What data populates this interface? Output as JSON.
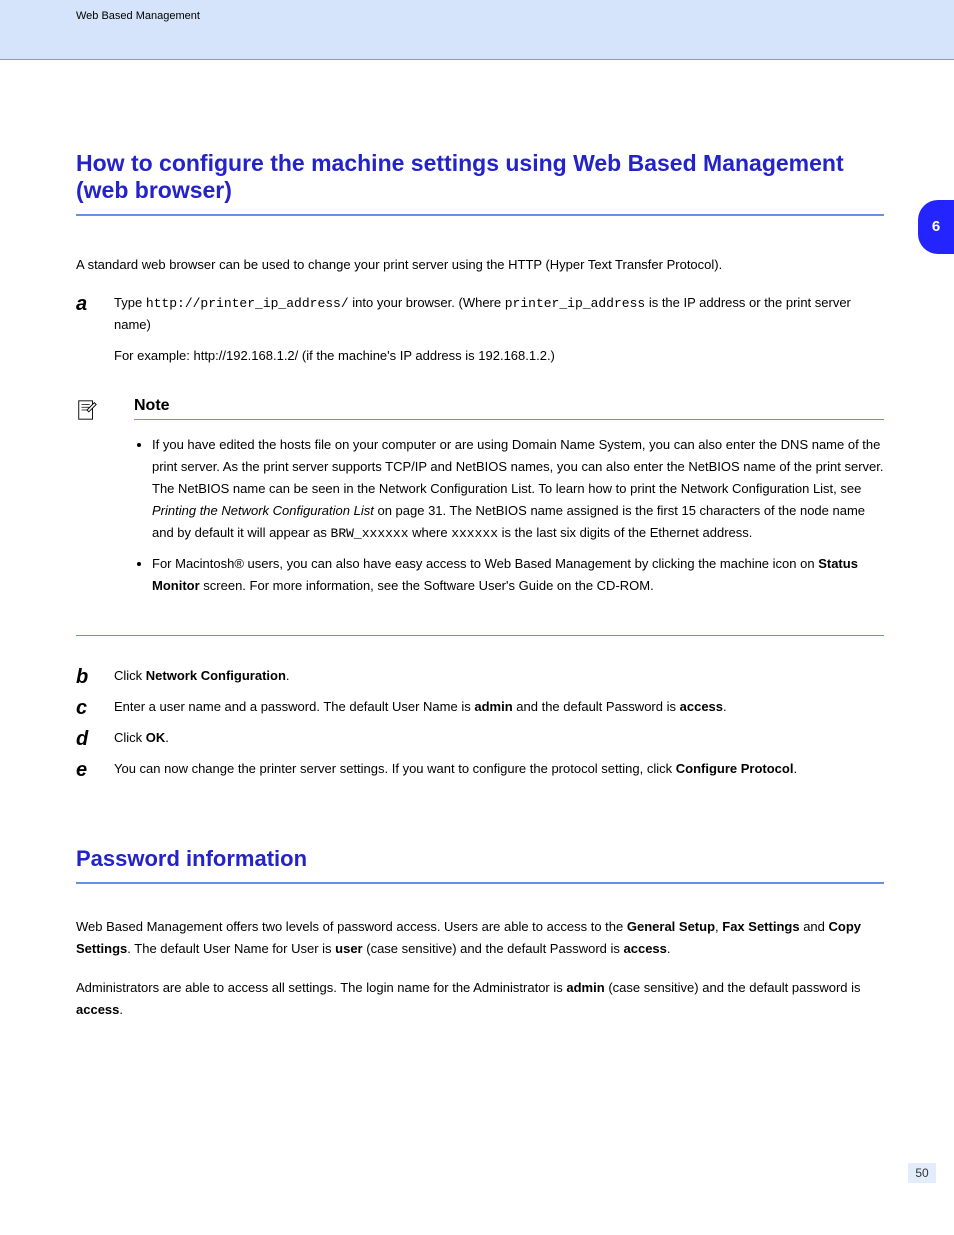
{
  "header": {
    "breadcrumb": "Web Based Management"
  },
  "page_tab": "6",
  "page_number": "50",
  "section1": {
    "title": "How to configure the machine settings using Web Based Management (web browser)",
    "intro": "A standard web browser can be used to change your print server using the HTTP (Hyper Text Transfer Protocol).",
    "step1_body_a": "Type",
    "step1_code_a": "http://printer_ip_address/",
    "step1_body_b": "into your browser. (Where",
    "step1_code_b": "printer_ip_address",
    "step1_body_c": "is the IP address or the print server name)",
    "step1_example": "For example: http://192.168.1.2/ (if the machine's IP address is 192.168.1.2.)"
  },
  "note": {
    "label": "Note",
    "item1": "If you have edited the hosts file on your computer or are using Domain Name System, you can also enter the DNS name of the print server. As the print server supports TCP/IP and NetBIOS names, you can also enter the NetBIOS name of the print server. The NetBIOS name can be seen in the Network Configuration List. To learn how to print the Network Configuration List, see",
    "item1_link": "Printing the Network Configuration List",
    "item1_after": "on page 31. The NetBIOS name assigned is the first 15 characters of the node name and by default it will appear as",
    "item1_code_a": "BRW_xxxxxx",
    "item1_mid": "where",
    "item1_code_b": "xxxxxx",
    "item1_tail": "is the last six digits of the Ethernet address.",
    "item2": "For Macintosh® users, you can also have easy access to Web Based Management by clicking the machine icon on",
    "item2_bold": "Status Monitor",
    "item2_after": "screen. For more information, see the Software User's Guide on the CD-ROM."
  },
  "steps_after": {
    "s2": "Click",
    "s2_bold": "Network Configuration",
    "s2_end": ".",
    "s3": "Enter a user name and a password. The default User Name is",
    "s3_bold_a": "admin",
    "s3_mid": "and the default Password is",
    "s3_bold_b": "access",
    "s3_end": ".",
    "s4": "Click",
    "s4_bold": "OK",
    "s4_end": ".",
    "s5": "You can now change the printer server settings. If you want to configure the protocol setting, click",
    "s5_bold": "Configure Protocol",
    "s5_end": "."
  },
  "section2": {
    "title": "Password information",
    "p1_a": "Web Based Management offers two levels of password access. Users are able to access to the",
    "p1_b1": "General Setup",
    "p1_c": ",",
    "p1_b2": "Fax Settings",
    "p1_d": "and",
    "p1_b3": "Copy Settings",
    "p1_e": ". The default User Name for User is",
    "p1_b4": "user",
    "p1_f": "(case sensitive) and the default Password is",
    "p1_b5": "access",
    "p1_g": ".",
    "p2_a": "Administrators are able to access all settings. The login name for the Administrator is",
    "p2_b1": "admin",
    "p2_b": "(case sensitive) and the default password is",
    "p2_b2": "access",
    "p2_c": "."
  }
}
